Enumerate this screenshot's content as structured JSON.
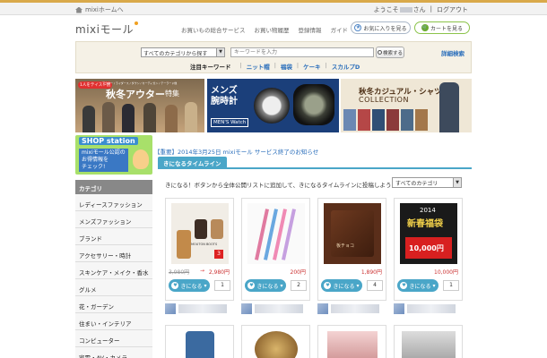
{
  "util": {
    "home_link": "mixiホームへ",
    "greeting_prefix": "ようこそ",
    "greeting_suffix": "さん",
    "separator": "|",
    "logout": "ログアウト"
  },
  "header": {
    "logo": "mixiモール",
    "nav": [
      "お買いもの総合サービス",
      "お買い物履歴",
      "登録情報",
      "ガイド"
    ],
    "favorites_button": "お気に入りを見る",
    "cart_button": "カートを見る"
  },
  "search": {
    "category_value": "すべてのカテゴリから探す",
    "keyword_placeholder": "キーワードを入力",
    "search_button": "検索する",
    "advanced": "詳細検索",
    "keyword_label": "注目キーワード",
    "keywords": [
      "ニット帽",
      "福袋",
      "ケーキ",
      "スカルプD"
    ]
  },
  "banners": {
    "b1_tag": "1人をテイスト別",
    "b1_sub": "アウター / ライダース / ダウン / カーディガン / テーラード他",
    "b1_title": "秋冬アウター",
    "b1_title2": "特集",
    "b2_title_line1": "メンズ",
    "b2_title_line2": "腕時計",
    "b2_sub": "MEN'S Watch",
    "b3_title": "秋冬カジュアル・シャツ",
    "b3_title2": "COLLECTION"
  },
  "sidebar": {
    "shop_title": "SHOP station",
    "shop_line1": "mixiモール公認の",
    "shop_line2": "お得情報を",
    "shop_line3": "チェック!",
    "category_header": "カテゴリ",
    "categories": [
      "レディースファッション",
      "メンズファッション",
      "ブランド",
      "アクセサリー・時計",
      "スキンケア・メイク・香水",
      "グルメ",
      "花・ガーデン",
      "住まい・インテリア",
      "コンピューター",
      "家電・AV・カメラ"
    ]
  },
  "main": {
    "notice": "【重要】2014年3月25日 mixiモール サービス終了のお知らせ",
    "timeline_tab": "きになるタイムライン",
    "timeline_desc": "きになる！ボタンから全体公開リストに追加して、きになるタイムラインに投稿しよう！",
    "timeline_select": "すべてのカテゴリ",
    "like_label": "きになる",
    "cards": [
      {
        "old_price": "3,980円",
        "arrow": "→",
        "price": "2,980円",
        "count": "1",
        "thumb_text": "MOUTON BOOTS"
      },
      {
        "price": "200円",
        "count": "2"
      },
      {
        "price": "1,890円",
        "count": "4",
        "thumb_text": "板チョコ"
      },
      {
        "price": "10,000円",
        "count": "1",
        "thumb_line1": "2014",
        "thumb_line2": "新春福袋",
        "thumb_line3": "10,000円"
      }
    ]
  },
  "colors": {
    "accent_blue": "#4aa6c8",
    "link_blue": "#2a6ebb",
    "price_red": "#cc3333",
    "brand_gold": "#d9a94a"
  }
}
